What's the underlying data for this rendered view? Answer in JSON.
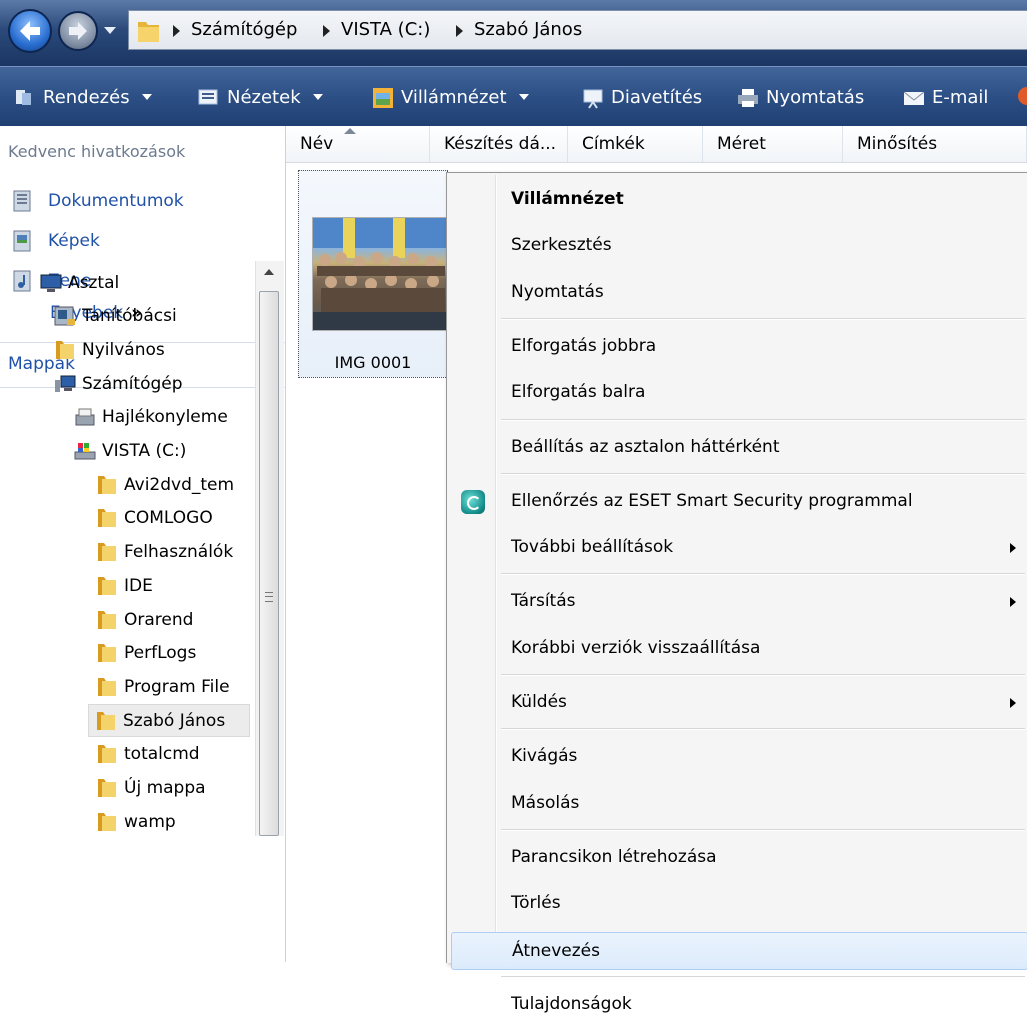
{
  "address_bar": {
    "crumbs": [
      "Számítógép",
      "VISTA (C:)",
      "Szabó János"
    ]
  },
  "toolbar": {
    "organize": "Rendezés",
    "views": "Nézetek",
    "preview": "Villámnézet",
    "slideshow": "Diavetítés",
    "print": "Nyomtatás",
    "email": "E-mail"
  },
  "left_pane": {
    "favorites_header": "Kedvenc hivatkozások",
    "favorites": [
      {
        "label": "Dokumentumok",
        "icon": "documents-icon"
      },
      {
        "label": "Képek",
        "icon": "pictures-icon"
      },
      {
        "label": "Zene",
        "icon": "music-icon"
      }
    ],
    "more_label": "Egyebek",
    "more_arrow": "»",
    "folders_label": "Mappák"
  },
  "tree": [
    {
      "label": "Asztal",
      "icon": "desktop-icon"
    },
    {
      "label": "Tanítóbácsi",
      "icon": "user-folder-icon"
    },
    {
      "label": "Nyilvános",
      "icon": "folder-icon"
    },
    {
      "label": "Számítógép",
      "icon": "computer-icon"
    },
    {
      "label": "Hajlékonyleme",
      "icon": "floppy-icon"
    },
    {
      "label": "VISTA (C:)",
      "icon": "drive-icon"
    },
    {
      "label": "Avi2dvd_tem",
      "icon": "folder-icon"
    },
    {
      "label": "COMLOGO",
      "icon": "folder-icon"
    },
    {
      "label": "Felhasználók",
      "icon": "folder-icon"
    },
    {
      "label": "IDE",
      "icon": "folder-icon"
    },
    {
      "label": "Orarend",
      "icon": "folder-icon"
    },
    {
      "label": "PerfLogs",
      "icon": "folder-icon"
    },
    {
      "label": "Program File",
      "icon": "folder-icon"
    },
    {
      "label": "Szabó János",
      "icon": "folder-icon",
      "selected": true
    },
    {
      "label": "totalcmd",
      "icon": "folder-icon"
    },
    {
      "label": "Új mappa",
      "icon": "folder-icon"
    },
    {
      "label": "wamp",
      "icon": "folder-icon"
    }
  ],
  "columns": [
    "Név",
    "Készítés dá...",
    "Címkék",
    "Méret",
    "Minősítés"
  ],
  "file": {
    "name": "IMG 0001",
    "thumbnail": "photo-thumbnail"
  },
  "context_menu": {
    "items": [
      {
        "label": "Villámnézet",
        "bold": true
      },
      {
        "label": "Szerkesztés"
      },
      {
        "label": "Nyomtatás"
      },
      {
        "separator": true
      },
      {
        "label": "Elforgatás jobbra"
      },
      {
        "label": "Elforgatás balra"
      },
      {
        "separator": true
      },
      {
        "label": "Beállítás az asztalon háttérként"
      },
      {
        "separator": true
      },
      {
        "label": "Ellenőrzés az ESET Smart Security programmal",
        "icon": "eset-icon"
      },
      {
        "label": "További beállítások",
        "submenu": true
      },
      {
        "separator": true
      },
      {
        "label": "Társítás",
        "submenu": true
      },
      {
        "label": "Korábbi verziók visszaállítása"
      },
      {
        "separator": true
      },
      {
        "label": "Küldés",
        "submenu": true
      },
      {
        "separator": true
      },
      {
        "label": "Kivágás"
      },
      {
        "label": "Másolás"
      },
      {
        "separator": true
      },
      {
        "label": "Parancsikon létrehozása"
      },
      {
        "label": "Törlés"
      },
      {
        "label": "Átnevezés",
        "hover": true
      },
      {
        "separator": true
      },
      {
        "label": "Tulajdonságok"
      }
    ]
  },
  "colors": {
    "toolbar_bg": "#2c4f85",
    "link_blue": "#1f52a8",
    "menu_bg": "#f5f5f5",
    "hover_border": "#aecdf3"
  }
}
